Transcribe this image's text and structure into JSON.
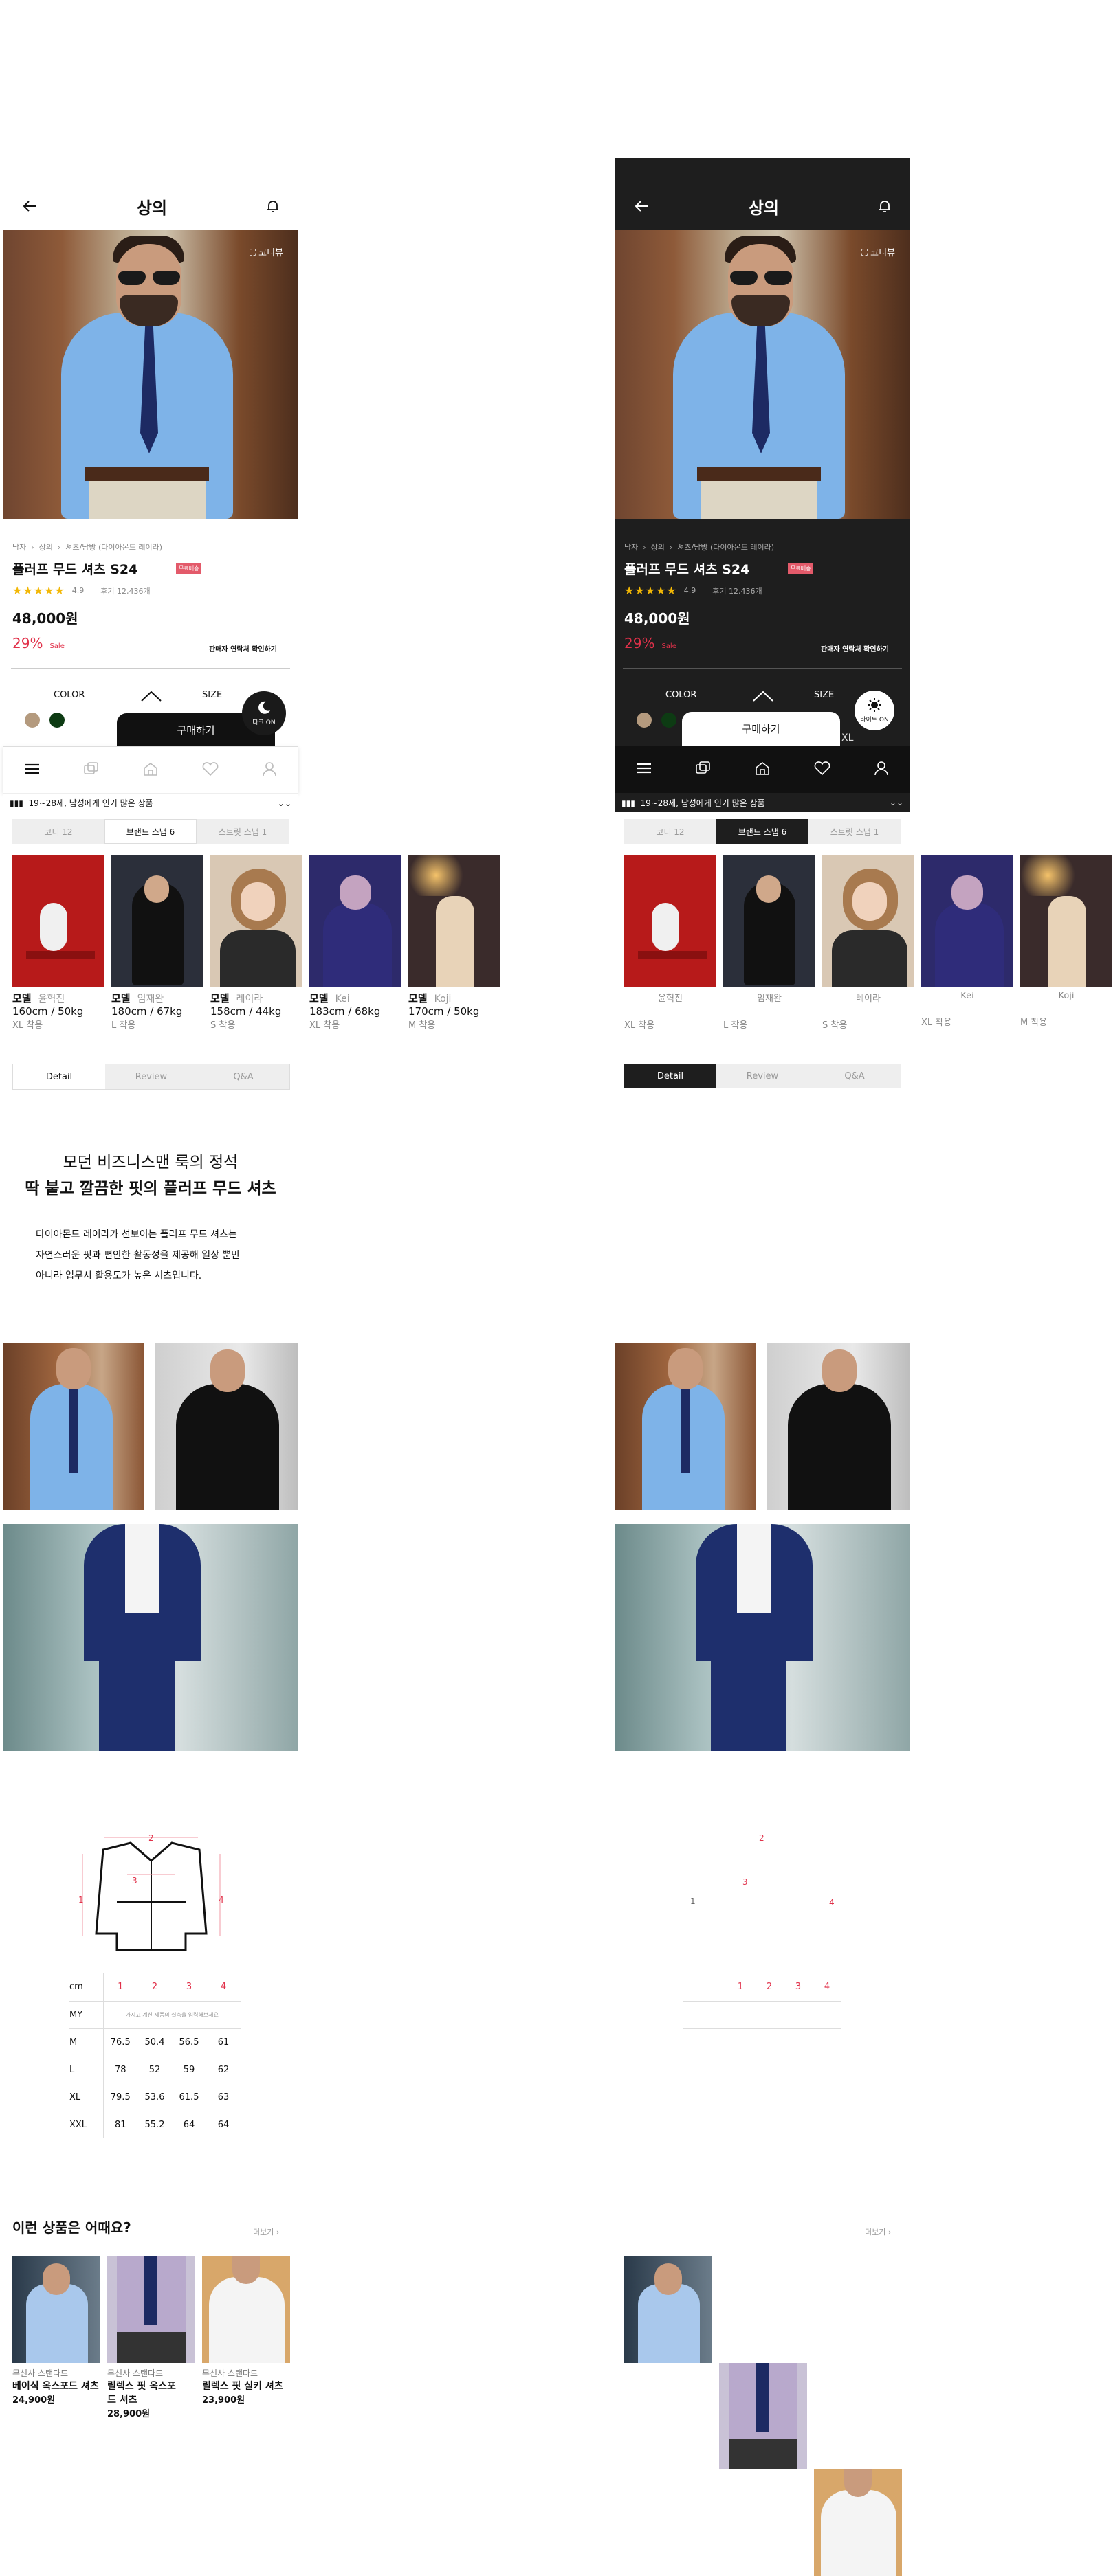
{
  "header": {
    "title": "상의"
  },
  "hero": {
    "codi_label": "코디뷰"
  },
  "product": {
    "breadcrumb": [
      "남자",
      "상의",
      "셔츠/남방 (다이아몬드 레이라)"
    ],
    "name": "플러프 무드 셔츠 S24",
    "badge": "무료배송",
    "stars": "★★★★★",
    "rating": "4.9",
    "review_count": "후기 12,436개",
    "price": "48,000원",
    "discount": "29%",
    "sale_label": "Sale",
    "seller_check": "판매자 연락처 확인하기"
  },
  "options": {
    "color_label": "COLOR",
    "size_label": "SIZE",
    "size_hint": "XL",
    "swatches": [
      "#b49a7e",
      "#0d3b13"
    ]
  },
  "buy": {
    "label": "구매하기"
  },
  "mode_light_page": {
    "label": "다크 ON"
  },
  "mode_dark_page": {
    "label": "라이트 ON"
  },
  "ribbon": {
    "text": "19~28세, 남성에게 인기 많은 상품"
  },
  "style_tabs": [
    "코디 12",
    "브랜드 스냅 6",
    "스트릿 스냅 1"
  ],
  "models": [
    {
      "prefix": "모델",
      "nick": "윤혁진",
      "stat": "160cm  /  50kg",
      "size": "XL 착용",
      "bg": "#b71a1a"
    },
    {
      "prefix": "모델",
      "nick": "임재완",
      "stat": "180cm  /  67kg",
      "size": "L 착용",
      "bg": "#2b2f3a"
    },
    {
      "prefix": "모델",
      "nick": "레이라",
      "stat": "158cm  /  44kg",
      "size": "S 착용",
      "bg": "#d9c8b4"
    },
    {
      "prefix": "모델",
      "nick": "Kei",
      "stat": "183cm  /  68kg",
      "size": "XL 착용",
      "bg": "#2d2a6b"
    },
    {
      "prefix": "모델",
      "nick": "Koji",
      "stat": "170cm  /  50kg",
      "size": "M 착용",
      "bg": "#3a2b2b"
    }
  ],
  "detail_tabs": [
    "Detail",
    "Review",
    "Q&A"
  ],
  "intro": {
    "line1": "모던 비즈니스맨 룩의 정석",
    "line2": "딱 붙고 깔끔한 핏의 플러프 무드 셔츠",
    "desc": [
      "다이아몬드 레이라가 선보이는 플러프 무드 셔츠는",
      "자연스러운 핏과 편안한 활동성을 제공해 일상 뿐만",
      "아니라 업무시 활용도가 높은 셔츠입니다."
    ]
  },
  "size_chart": {
    "marks": [
      "1",
      "2",
      "3",
      "4"
    ],
    "header": [
      "cm",
      "1",
      "2",
      "3",
      "4"
    ],
    "my_label": "MY",
    "my_note": "가지고 계신 제품의 실측을 입력해보세요",
    "rows": [
      [
        "M",
        "76.5",
        "50.4",
        "56.5",
        "61"
      ],
      [
        "L",
        "78",
        "52",
        "59",
        "62"
      ],
      [
        "XL",
        "79.5",
        "53.6",
        "61.5",
        "63"
      ],
      [
        "XXL",
        "81",
        "55.2",
        "64",
        "64"
      ]
    ]
  },
  "recommend": {
    "title": "이런 상품은 어때요?",
    "more": "더보기",
    "items": [
      {
        "brand": "무신사 스탠다드",
        "name": "베이식 옥스포드 셔츠",
        "price": "24,900원"
      },
      {
        "brand": "무신사 스탠다드",
        "name": "릴렉스 핏 옥스포드 셔츠",
        "price": "28,900원"
      },
      {
        "brand": "무신사 스탠다드",
        "name": "릴렉스 핏 실키 셔츠",
        "price": "23,900원"
      }
    ]
  }
}
